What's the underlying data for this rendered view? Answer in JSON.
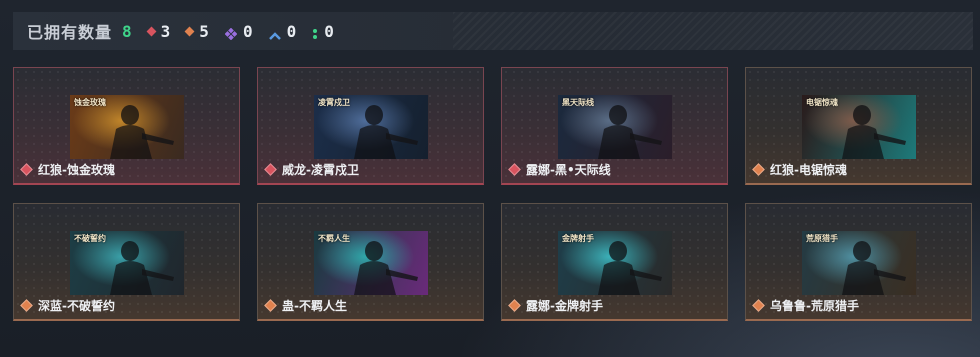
{
  "summary": {
    "label": "已拥有数量",
    "total": "8",
    "stats": [
      {
        "icon": "red-diamond-icon",
        "color": "#d8545f",
        "count": "3"
      },
      {
        "icon": "orange-diamond-icon",
        "color": "#e0824f",
        "count": "5"
      },
      {
        "icon": "purple-diamond-icon",
        "color": "#9a6fe0",
        "count": "0"
      },
      {
        "icon": "blue-chevron-icon",
        "color": "#5a9ae0",
        "count": "0"
      },
      {
        "icon": "green-dots-icon",
        "color": "#3fd48a",
        "count": "0"
      }
    ]
  },
  "cards": [
    {
      "name": "红狼-蚀金玫瑰",
      "rarity": "red",
      "logo": "蚀金玫瑰",
      "colors": [
        "#6b3b18",
        "#c0852a",
        "#3a2a20"
      ]
    },
    {
      "name": "威龙-凌霄戍卫",
      "rarity": "red",
      "logo": "凌霄戍卫",
      "colors": [
        "#1c2e4a",
        "#4f6d9a",
        "#15202e"
      ]
    },
    {
      "name": "露娜-黑•天际线",
      "rarity": "red",
      "logo": "黑天际线",
      "colors": [
        "#1b2a3e",
        "#5a6d86",
        "#2b1e2a"
      ]
    },
    {
      "name": "红狼-电锯惊魂",
      "rarity": "orange",
      "logo": "电锯惊魂",
      "colors": [
        "#2a1a1a",
        "#7d5a4a",
        "#1d7a7a"
      ]
    },
    {
      "name": "深蓝-不破誓约",
      "rarity": "orange",
      "logo": "不破誓约",
      "colors": [
        "#1d3e46",
        "#3aa0a8",
        "#20262c"
      ]
    },
    {
      "name": "蛊-不羁人生",
      "rarity": "orange",
      "logo": "不羁人生",
      "colors": [
        "#1a3b40",
        "#2fa7a8",
        "#6a2a7a"
      ]
    },
    {
      "name": "露娜-金牌射手",
      "rarity": "orange",
      "logo": "金牌射手",
      "colors": [
        "#1e3e4a",
        "#3bb0b8",
        "#2a2a2a"
      ]
    },
    {
      "name": "乌鲁鲁-荒原猎手",
      "rarity": "orange",
      "logo": "荒原猎手",
      "colors": [
        "#243b44",
        "#4f8fa0",
        "#3a2e22"
      ]
    }
  ]
}
